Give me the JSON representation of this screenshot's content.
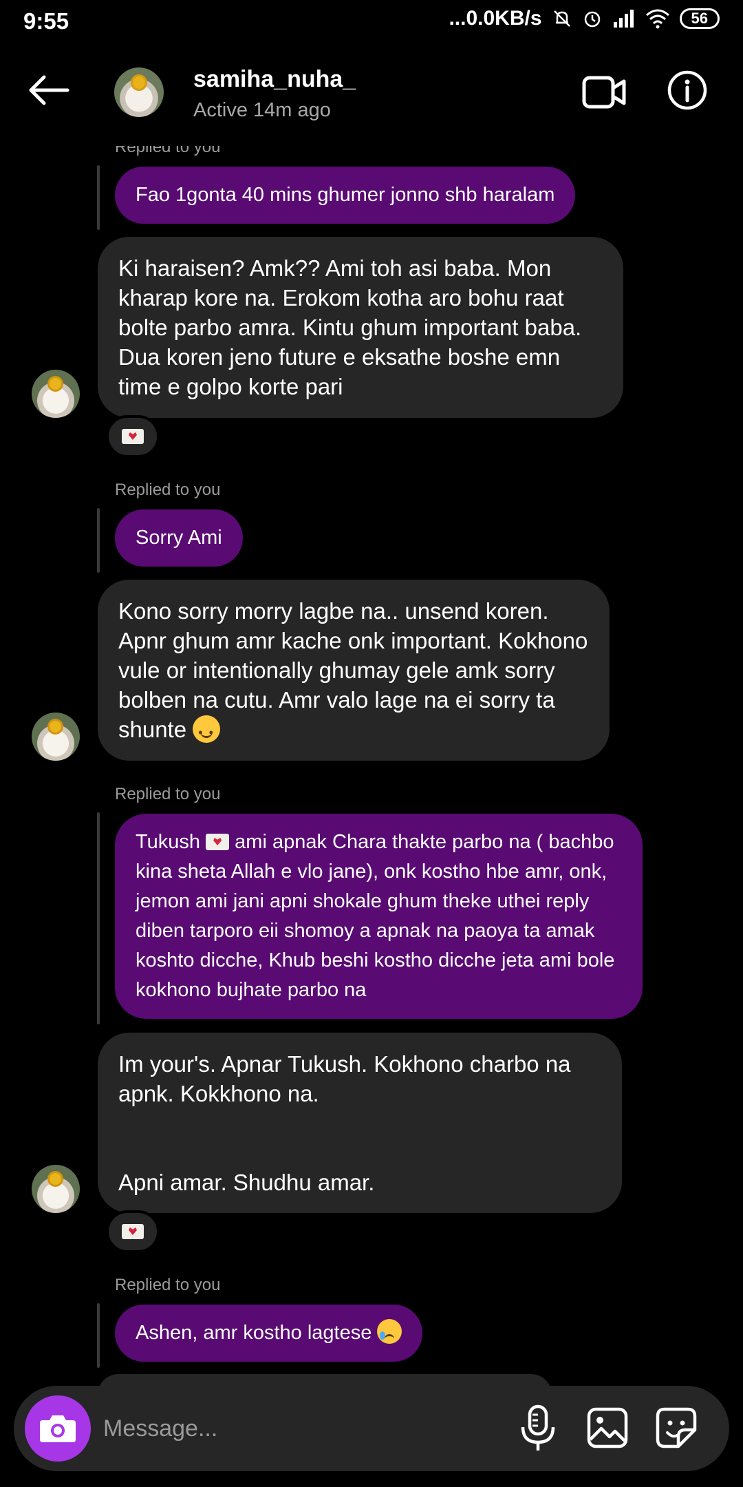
{
  "status_bar": {
    "time": "9:55",
    "network_speed": "...0.0KB/s",
    "battery": "56",
    "icons": [
      "mute-bell-icon",
      "alarm-icon",
      "signal-icon",
      "wifi-icon",
      "battery-icon"
    ]
  },
  "header": {
    "username": "samiha_nuha_",
    "status": "Active 14m ago",
    "icons": [
      "back-arrow-icon",
      "video-call-icon",
      "info-icon"
    ]
  },
  "messages": [
    {
      "type": "replied_label",
      "text": "Replied to you"
    },
    {
      "type": "sent",
      "text": "Fao 1gonta 40 mins ghumer jonno shb haralam"
    },
    {
      "type": "received",
      "text": "Ki haraisen? Amk?? Ami toh asi baba. Mon kharap kore na. Erokom kotha aro bohu raat bolte parbo amra. Kintu ghum important baba. Dua koren jeno future e eksathe boshe emn time e golpo korte pari",
      "reaction": "love-letter"
    },
    {
      "type": "replied_label",
      "text": "Replied to you"
    },
    {
      "type": "sent",
      "text": "Sorry Ami"
    },
    {
      "type": "received",
      "text": "Kono sorry morry lagbe na.. unsend koren. Apnr ghum amr kache onk important. Kokhono vule or intentionally ghumay gele amk sorry bolben na cutu. Amr valo lage na ei sorry ta shunte"
    },
    {
      "type": "replied_label",
      "text": "Replied to you"
    },
    {
      "type": "sent",
      "text_before": "Tukush",
      "text_after": "ami apnak Chara thakte parbo na ( bachbo kina sheta Allah e vlo jane), onk kostho hbe amr, onk, jemon ami jani apni shokale ghum theke uthei reply diben tarporo eii shomoy a apnak na paoya ta amak koshto dicche, Khub beshi kostho dicche jeta ami bole kokhono bujhate parbo na"
    },
    {
      "type": "received",
      "line1": "Im your's. Apnar Tukush. Kokhono charbo na apnk. Kokkhono na.",
      "line2": "Apni amar. Shudhu amar.",
      "reaction": "love-letter"
    },
    {
      "type": "replied_label",
      "text": "Replied to you"
    },
    {
      "type": "sent",
      "text": "Ashen, amr kostho lagtese"
    }
  ],
  "composer": {
    "placeholder": "Message..."
  },
  "colors": {
    "sent_bubble": "#590a73",
    "received_bubble": "#262626",
    "camera_button": "#a737e6",
    "background": "#000000"
  }
}
